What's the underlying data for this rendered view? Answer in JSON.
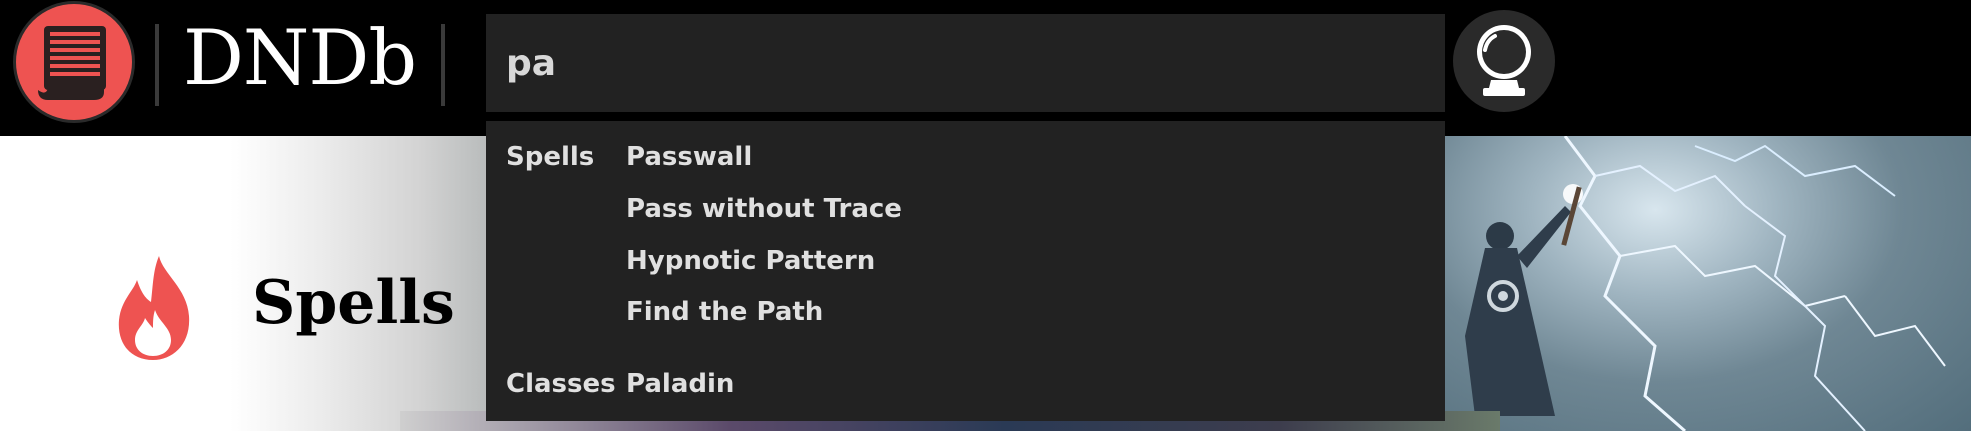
{
  "header": {
    "brand": "DNDb",
    "logo_icon": "scroll-icon",
    "brand_color": "#ee5351"
  },
  "search": {
    "value": "pa",
    "button_icon": "crystal-ball-icon"
  },
  "dropdown": {
    "groups": [
      {
        "label": "Spells",
        "items": [
          "Passwall",
          "Pass without Trace",
          "Hypnotic Pattern",
          "Find the Path"
        ]
      },
      {
        "label": "Classes",
        "items": [
          "Paladin"
        ]
      }
    ]
  },
  "page": {
    "title": "Spells",
    "title_icon": "flame-icon",
    "accent_color": "#ee5351"
  }
}
